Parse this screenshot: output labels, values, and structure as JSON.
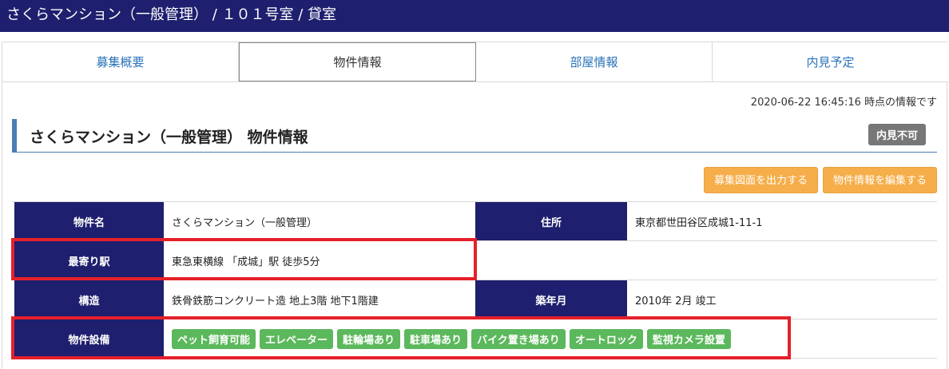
{
  "header": {
    "title": "さくらマンション（一般管理） / １０１号室 / 貸室"
  },
  "tabs": [
    {
      "label": "募集概要"
    },
    {
      "label": "物件情報"
    },
    {
      "label": "部屋情報"
    },
    {
      "label": "内見予定"
    }
  ],
  "timestamp": "2020-06-22 16:45:16 時点の情報です",
  "section": {
    "title": "さくらマンション（一般管理） 物件情報",
    "badge": "内見不可"
  },
  "actions": {
    "export_label": "募集図面を出力する",
    "edit_label": "物件情報を編集する"
  },
  "details": {
    "name_label": "物件名",
    "name_value": "さくらマンション（一般管理）",
    "address_label": "住所",
    "address_value": "東京都世田谷区成城1-11-1",
    "station_label": "最寄り駅",
    "station_value": "東急東横線 「成城」駅 徒歩5分",
    "structure_label": "構造",
    "structure_value": "鉄骨鉄筋コンクリート造 地上3階 地下1階建",
    "built_label": "築年月",
    "built_value": "2010年 2月 竣工",
    "equipment_label": "物件設備",
    "equipment": [
      "ペット飼育可能",
      "エレベーター",
      "駐輪場あり",
      "駐車場あり",
      "バイク置き場あり",
      "オートロック",
      "監視カメラ設置"
    ]
  },
  "colors": {
    "header_bg": "#1e1f6e",
    "accent": "#4a7fb5",
    "button": "#f5ae4a",
    "tag": "#5cb85c",
    "highlight": "#e5202a"
  }
}
